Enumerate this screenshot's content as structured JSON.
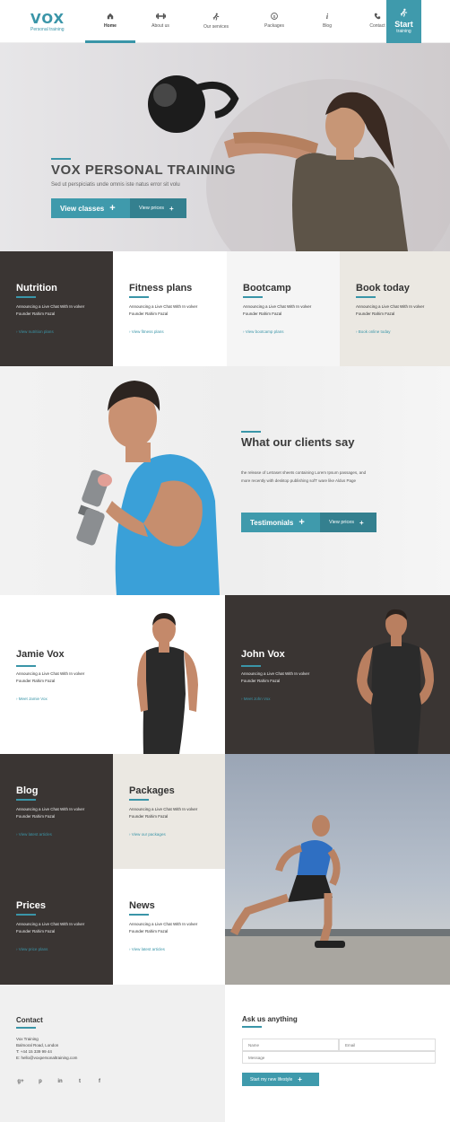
{
  "header": {
    "brand": "VOX",
    "tagline": "Personal training",
    "nav": [
      {
        "label": "Home",
        "icon": "home-icon"
      },
      {
        "label": "About us",
        "icon": "dumbbell-icon"
      },
      {
        "label": "Our services",
        "icon": "runner-icon"
      },
      {
        "label": "Packages",
        "icon": "dollar-icon"
      },
      {
        "label": "Blog",
        "icon": "info-icon"
      },
      {
        "label": "Contact",
        "icon": "phone-icon"
      }
    ],
    "start_big": "Start",
    "start_small": "training"
  },
  "hero": {
    "title": "VOX PERSONAL TRAINING",
    "subtitle": "Sed ut perspiciatis unde omnis iste natus error sit volu",
    "primary_label": "View classes",
    "secondary_label": "View prices"
  },
  "features": [
    {
      "title": "Nutrition",
      "text": "Announcing a Live Chat With In volver Founder Rahim Fazal",
      "link": "View nutrition plans"
    },
    {
      "title": "Fitness plans",
      "text": "Announcing a Live Chat With In volver Founder Rahim Fazal",
      "link": "View fitness plans"
    },
    {
      "title": "Bootcamp",
      "text": "Announcing a Live Chat With In volver Founder Rahim Fazal",
      "link": "View bootcamp plans"
    },
    {
      "title": "Book today",
      "text": "Announcing a Live Chat With In volver Founder Rahim Fazal",
      "link": "Book online today"
    }
  ],
  "clients": {
    "title": "What our clients say",
    "text": "the release of Letraset sheets containing Lorem Ipsum passages, and more recently with desktop publishing sofT ware like Aldus Page",
    "primary_label": "Testimonials",
    "secondary_label": "View prices"
  },
  "trainers": [
    {
      "name": "Jamie Vox",
      "text": "Announcing a Live Chat With In volver Founder Rahim Fazal",
      "link": "Meet Jamie Vox"
    },
    {
      "name": "John Vox",
      "text": "Announcing a Live Chat With In volver Founder Rahim Fazal",
      "link": "Meet John  Vox"
    }
  ],
  "bottom": [
    {
      "title": "Blog",
      "text": "Announcing a Live Chat With In volver Founder Rahim Fazal",
      "link": "View latest articles"
    },
    {
      "title": "Packages",
      "text": "Announcing a Live Chat With In volver Founder Rahim Fazal",
      "link": "View our packages"
    },
    {
      "title": "Prices",
      "text": "Announcing a Live Chat With In volver Founder Rahim Fazal",
      "link": "View price plans"
    },
    {
      "title": "News",
      "text": "Announcing a Live Chat With In volver Founder Rahim Fazal",
      "link": "View latest articles"
    }
  ],
  "contact": {
    "title": "Contact",
    "lines": [
      "Vox Training",
      "Balmoral Road, London",
      "T: +44 15 339 99 44",
      "E: hello@voxpersonaltraining.com"
    ],
    "socials": [
      "g+",
      "p",
      "in",
      "t",
      "f"
    ]
  },
  "ask": {
    "title": "Ask us anything",
    "name_placeholder": "Name",
    "email_placeholder": "Email",
    "message_placeholder": "Message",
    "submit_label": "Start my new lifestyle"
  },
  "colors": {
    "accent": "#3f9aac",
    "dark": "#3a3533",
    "beige": "#ebe8e2"
  }
}
